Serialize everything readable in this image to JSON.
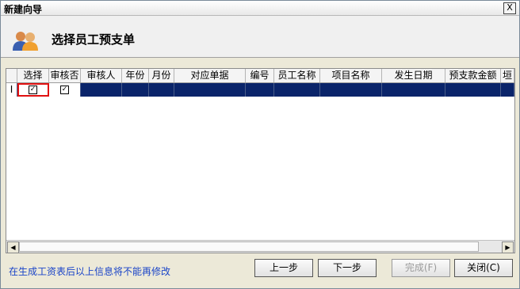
{
  "window": {
    "title": "新建向导",
    "close_label": "X"
  },
  "header": {
    "title": "选择员工预支单",
    "icon": "people-icon"
  },
  "grid": {
    "columns": [
      "选择",
      "审核否",
      "审核人",
      "年份",
      "月份",
      "对应单据",
      "编号",
      "员工名称",
      "项目名称",
      "发生日期",
      "预支款金额",
      "垣"
    ],
    "row": {
      "indicator": "I",
      "select_checked": "✓",
      "audit_checked": "✓"
    }
  },
  "footer": {
    "note": "在生成工资表后以上信息将不能再修改",
    "prev": "上一步",
    "next": "下一步",
    "finish": "完成(F)",
    "close": "关闭(C)"
  },
  "colors": {
    "selection": "#0a246a",
    "note": "#1a44c8",
    "highlight": "#e01010"
  }
}
